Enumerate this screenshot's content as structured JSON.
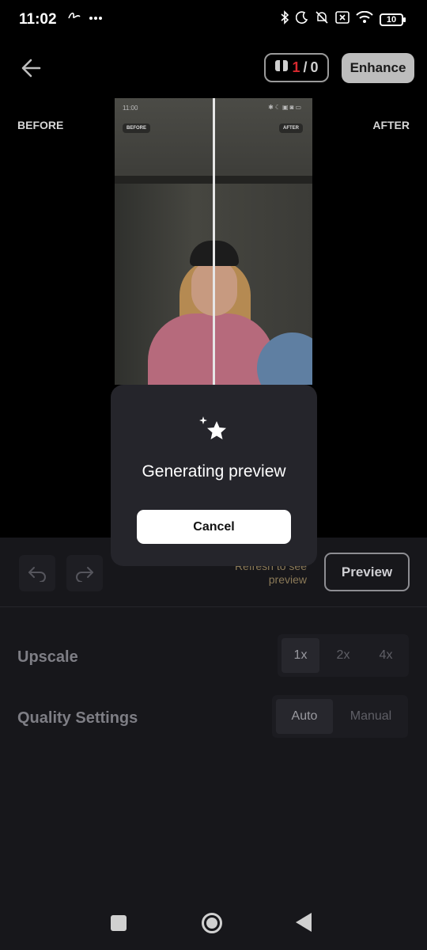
{
  "status_bar": {
    "time": "11:02",
    "left_icons": [
      "handwriting-icon",
      "more-dots-icon"
    ],
    "right_icons": [
      "bluetooth-icon",
      "moon-icon",
      "muted-bell-icon",
      "no-sim-icon",
      "wifi-icon"
    ],
    "battery": "10"
  },
  "header": {
    "credits_used": "1",
    "credits_separator": "/",
    "credits_total": "0",
    "enhance_label": "Enhance"
  },
  "compare": {
    "before_label": "BEFORE",
    "after_label": "AFTER",
    "inner_time": "11:00",
    "inner_before_tag": "BEFORE",
    "inner_after_tag": "AFTER"
  },
  "toolbar": {
    "refresh_hint": "Refresh to see preview",
    "preview_label": "Preview"
  },
  "settings": {
    "upscale": {
      "label": "Upscale",
      "options": [
        "1x",
        "2x",
        "4x"
      ],
      "selected": "1x"
    },
    "quality": {
      "label": "Quality Settings",
      "options": [
        "Auto",
        "Manual"
      ],
      "selected": "Auto"
    }
  },
  "dialog": {
    "title": "Generating preview",
    "cancel_label": "Cancel",
    "icon": "sparkle-star-icon"
  },
  "colors": {
    "accent_red": "#d8292f",
    "panel_bg": "#17171b",
    "dialog_bg": "#25252b"
  }
}
